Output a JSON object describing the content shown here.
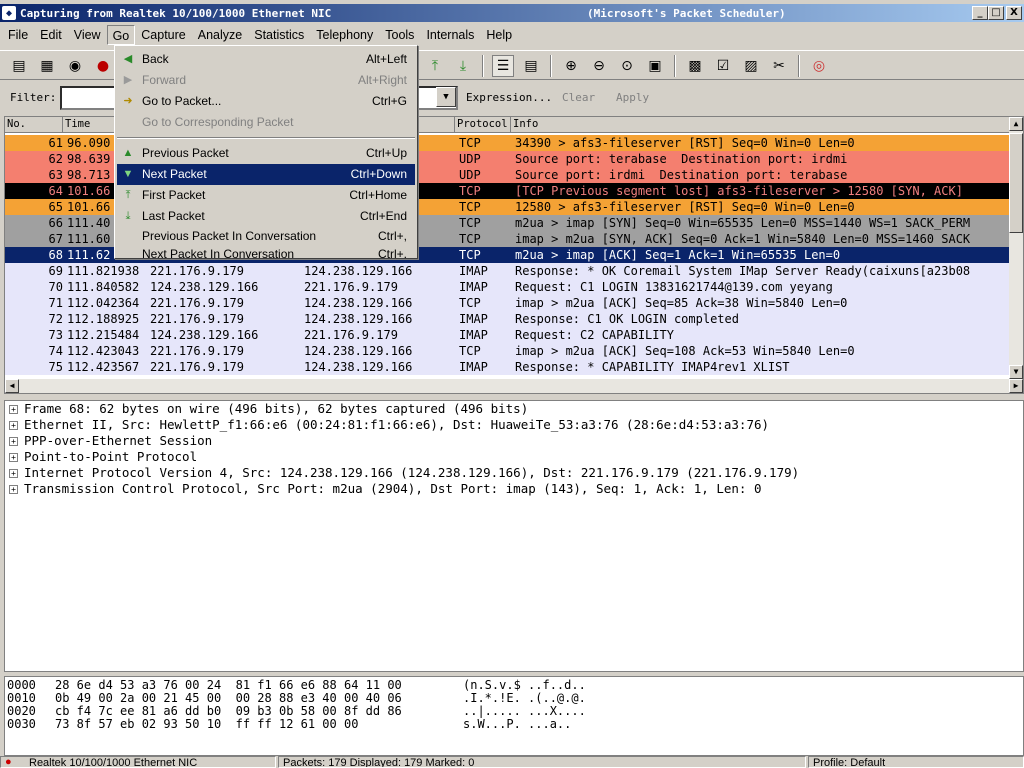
{
  "window": {
    "title": "Capturing from Realtek 10/100/1000 Ethernet NIC",
    "title_suffix": "(Microsoft's Packet Scheduler)",
    "buttons": {
      "minimize": "_",
      "maximize": "□",
      "close": "X"
    }
  },
  "menubar": [
    "File",
    "Edit",
    "View",
    "Go",
    "Capture",
    "Analyze",
    "Statistics",
    "Telephony",
    "Tools",
    "Internals",
    "Help"
  ],
  "filter": {
    "label": "Filter:",
    "value": "",
    "expression": "Expression...",
    "clear": "Clear",
    "apply": "Apply"
  },
  "go_menu": [
    {
      "label": "Back",
      "shortcut": "Alt+Left",
      "icon": "back-arrow-icon",
      "enabled": true
    },
    {
      "label": "Forward",
      "shortcut": "Alt+Right",
      "icon": "forward-arrow-icon",
      "enabled": false
    },
    {
      "label": "Go to Packet...",
      "shortcut": "Ctrl+G",
      "icon": "goto-packet-icon",
      "enabled": true
    },
    {
      "label": "Go to Corresponding Packet",
      "shortcut": "",
      "icon": "",
      "enabled": false
    },
    {
      "label": "Previous Packet",
      "shortcut": "Ctrl+Up",
      "icon": "up-arrow-icon",
      "enabled": true
    },
    {
      "label": "Next Packet",
      "shortcut": "Ctrl+Down",
      "icon": "down-arrow-icon",
      "enabled": true,
      "selected": true
    },
    {
      "label": "First Packet",
      "shortcut": "Ctrl+Home",
      "icon": "first-packet-icon",
      "enabled": true
    },
    {
      "label": "Last Packet",
      "shortcut": "Ctrl+End",
      "icon": "last-packet-icon",
      "enabled": true
    },
    {
      "label": "Previous Packet In Conversation",
      "shortcut": "Ctrl+,",
      "icon": "",
      "enabled": true
    },
    {
      "label": "Next Packet In Conversation",
      "shortcut": "Ctrl+.",
      "icon": "",
      "enabled": true
    }
  ],
  "packet_list": {
    "columns": [
      "No.",
      "Time",
      "Protocol",
      "Info"
    ],
    "rows": [
      {
        "no": "61",
        "time": "96.090",
        "src": "",
        "dst": "",
        "proto": "TCP",
        "info": "34390 > afs3-fileserver [RST] Seq=0 Win=0 Len=0",
        "bg": "#f4a235",
        "fg": "#000000"
      },
      {
        "no": "62",
        "time": "98.639",
        "src": "",
        "dst": "",
        "proto": "UDP",
        "info": "Source port: terabase  Destination port: irdmi",
        "bg": "#f47f6f",
        "fg": "#000000"
      },
      {
        "no": "63",
        "time": "98.713",
        "src": "",
        "dst": "6",
        "proto": "UDP",
        "info": "Source port: irdmi  Destination port: terabase",
        "bg": "#f47f6f",
        "fg": "#000000"
      },
      {
        "no": "64",
        "time": "101.66",
        "src": "",
        "dst": "6",
        "proto": "TCP",
        "info": "[TCP Previous segment lost] afs3-fileserver > 12580 [SYN, ACK]",
        "bg": "#000000",
        "fg": "#f08080"
      },
      {
        "no": "65",
        "time": "101.66",
        "src": "",
        "dst": "",
        "proto": "TCP",
        "info": "12580 > afs3-fileserver [RST] Seq=0 Win=0 Len=0",
        "bg": "#f4a235",
        "fg": "#000000"
      },
      {
        "no": "66",
        "time": "111.40",
        "src": "",
        "dst": "",
        "proto": "TCP",
        "info": "m2ua > imap [SYN] Seq=0 Win=65535 Len=0 MSS=1440 WS=1 SACK_PERM",
        "bg": "#a0a0a0",
        "fg": "#000000"
      },
      {
        "no": "67",
        "time": "111.60",
        "src": "",
        "dst": "6",
        "proto": "TCP",
        "info": "imap > m2ua [SYN, ACK] Seq=0 Ack=1 Win=5840 Len=0 MSS=1460 SACK",
        "bg": "#a0a0a0",
        "fg": "#000000"
      },
      {
        "no": "68",
        "time": "111.62",
        "src": "",
        "dst": "",
        "proto": "TCP",
        "info": "m2ua > imap [ACK] Seq=1 Ack=1 Win=65535 Len=0",
        "bg": "#0a246a",
        "fg": "#ffffff"
      },
      {
        "no": "69",
        "time": "111.821938",
        "src": "221.176.9.179",
        "dst": "124.238.129.166",
        "proto": "IMAP",
        "info": "Response: * OK Coremail System IMap Server Ready(caixuns[a23b08",
        "bg": "#e6e6fa",
        "fg": "#000000"
      },
      {
        "no": "70",
        "time": "111.840582",
        "src": "124.238.129.166",
        "dst": "221.176.9.179",
        "proto": "IMAP",
        "info": "Request: C1 LOGIN 13831621744@139.com yeyang",
        "bg": "#e6e6fa",
        "fg": "#000000"
      },
      {
        "no": "71",
        "time": "112.042364",
        "src": "221.176.9.179",
        "dst": "124.238.129.166",
        "proto": "TCP",
        "info": "imap > m2ua [ACK] Seq=85 Ack=38 Win=5840 Len=0",
        "bg": "#e6e6fa",
        "fg": "#000000"
      },
      {
        "no": "72",
        "time": "112.188925",
        "src": "221.176.9.179",
        "dst": "124.238.129.166",
        "proto": "IMAP",
        "info": "Response: C1 OK LOGIN completed",
        "bg": "#e6e6fa",
        "fg": "#000000"
      },
      {
        "no": "73",
        "time": "112.215484",
        "src": "124.238.129.166",
        "dst": "221.176.9.179",
        "proto": "IMAP",
        "info": "Request: C2 CAPABILITY",
        "bg": "#e6e6fa",
        "fg": "#000000"
      },
      {
        "no": "74",
        "time": "112.423043",
        "src": "221.176.9.179",
        "dst": "124.238.129.166",
        "proto": "TCP",
        "info": "imap > m2ua [ACK] Seq=108 Ack=53 Win=5840 Len=0",
        "bg": "#e6e6fa",
        "fg": "#000000"
      },
      {
        "no": "75",
        "time": "112.423567",
        "src": "221.176.9.179",
        "dst": "124.238.129.166",
        "proto": "IMAP",
        "info": "Response: * CAPABILITY IMAP4rev1 XLIST",
        "bg": "#e6e6fa",
        "fg": "#000000"
      }
    ]
  },
  "details": [
    "Frame 68: 62 bytes on wire (496 bits), 62 bytes captured (496 bits)",
    "Ethernet II, Src: HewlettP_f1:66:e6 (00:24:81:f1:66:e6), Dst: HuaweiTe_53:a3:76 (28:6e:d4:53:a3:76)",
    "PPP-over-Ethernet Session",
    "Point-to-Point Protocol",
    "Internet Protocol Version 4, Src: 124.238.129.166 (124.238.129.166), Dst: 221.176.9.179 (221.176.9.179)",
    "Transmission Control Protocol, Src Port: m2ua (2904), Dst Port: imap (143), Seq: 1, Ack: 1, Len: 0"
  ],
  "hex": [
    {
      "offset": "0000",
      "bytes": "28 6e d4 53 a3 76 00 24  81 f1 66 e6 88 64 11 00",
      "ascii": "(n.S.v.$ ..f..d.."
    },
    {
      "offset": "0010",
      "bytes": "0b 49 00 2a 00 21 45 00  00 28 88 e3 40 00 40 06",
      "ascii": ".I.*.!E. .(..@.@."
    },
    {
      "offset": "0020",
      "bytes": "cb f4 7c ee 81 a6 dd b0  09 b3 0b 58 00 8f dd 86",
      "ascii": "..|..... ...X...."
    },
    {
      "offset": "0030",
      "bytes": "73 8f 57 eb 02 93 50 10  ff ff 12 61 00 00",
      "ascii": "s.W...P. ...a.."
    }
  ],
  "status": {
    "interface": "Realtek 10/100/1000 Ethernet NIC",
    "packets": "Packets: 179 Displayed: 179 Marked: 0",
    "profile": "Profile: Default"
  }
}
